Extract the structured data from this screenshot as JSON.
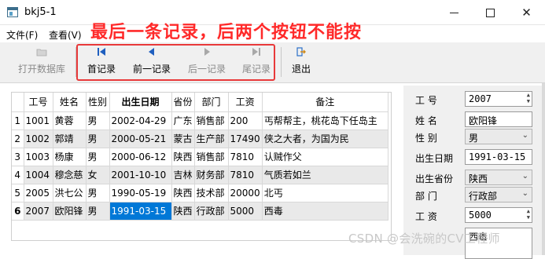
{
  "window": {
    "title": "bkj5-1"
  },
  "menu": {
    "items": [
      "文件(F)",
      "查看(V)"
    ]
  },
  "annotation": "最后一条记录，后两个按钮不能按",
  "colors": {
    "annotation": "#ff2a2a",
    "highlight_box": "#e8393a",
    "selection": "#0078d7"
  },
  "toolbar": {
    "buttons": [
      {
        "label": "打开数据库",
        "icon": "folder-icon",
        "enabled": false
      },
      {
        "label": "首记录",
        "icon": "first-record-icon",
        "enabled": true
      },
      {
        "label": "前一记录",
        "icon": "prev-record-icon",
        "enabled": true
      },
      {
        "label": "后一记录",
        "icon": "next-record-icon",
        "enabled": false
      },
      {
        "label": "尾记录",
        "icon": "last-record-icon",
        "enabled": false
      },
      {
        "label": "退出",
        "icon": "exit-icon",
        "enabled": true
      }
    ]
  },
  "table": {
    "columns": [
      "工号",
      "姓名",
      "性别",
      "出生日期",
      "省份",
      "部门",
      "工资",
      "备注"
    ],
    "sorted_column": "出生日期",
    "rows": [
      {
        "num": "1",
        "cells": [
          "1001",
          "黄蓉",
          "男",
          "2002-04-29",
          "广东",
          "销售部",
          "200",
          "丐帮帮主，桃花岛下任岛主"
        ]
      },
      {
        "num": "2",
        "cells": [
          "1002",
          "郭靖",
          "男",
          "2000-05-21",
          "蒙古",
          "生产部",
          "17490",
          "侠之大者，为国为民"
        ]
      },
      {
        "num": "3",
        "cells": [
          "1003",
          "杨康",
          "男",
          "2000-06-12",
          "陕西",
          "销售部",
          "7810",
          "认贼作父"
        ]
      },
      {
        "num": "4",
        "cells": [
          "1004",
          "穆念慈",
          "女",
          "2001-10-10",
          "吉林",
          "财务部",
          "7810",
          "气质若如兰"
        ]
      },
      {
        "num": "5",
        "cells": [
          "2005",
          "洪七公",
          "男",
          "1990-05-19",
          "陕西",
          "技术部",
          "20000",
          "北丐"
        ]
      },
      {
        "num": "6",
        "cells": [
          "2007",
          "欧阳锋",
          "男",
          "1991-03-15",
          "陕西",
          "行政部",
          "5000",
          "西毒"
        ]
      }
    ],
    "current_row": "6",
    "selected_cell": "1991-03-15"
  },
  "form": {
    "labels": {
      "empno": "工    号",
      "name": "姓    名",
      "gender": "性    别",
      "birth": "出生日期",
      "province": "出生省份",
      "dept": "部    门",
      "salary": "工    资"
    },
    "values": {
      "empno": "2007",
      "name": "欧阳锋",
      "gender": "男",
      "birth": "1991-03-15",
      "province": "陕西",
      "dept": "行政部",
      "salary": "5000",
      "memo": "西毒"
    }
  },
  "watermark": "CSDN @会洗碗的CV工程师"
}
